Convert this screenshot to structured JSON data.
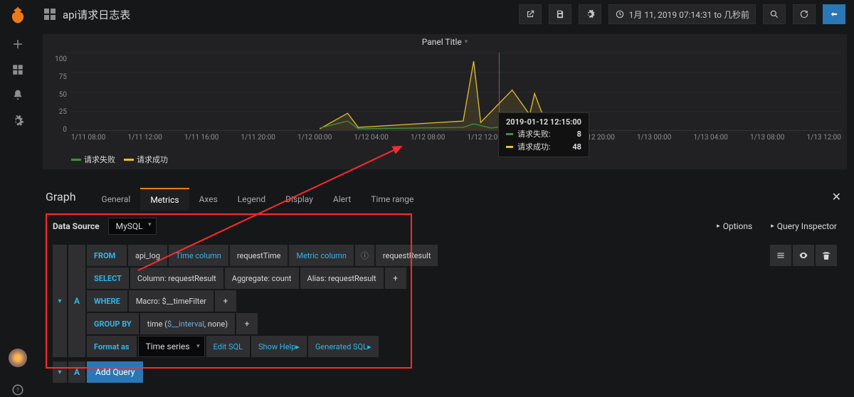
{
  "header": {
    "dashboard_title": "api请求日志表",
    "time_range": "1月 11, 2019 07:14:31 to 几秒前"
  },
  "sidebar": {
    "icons": [
      "plus-icon",
      "apps-icon",
      "bell-icon",
      "gear-icon",
      "help-icon"
    ]
  },
  "panel": {
    "title": "Panel Title",
    "tooltip": {
      "time": "2019-01-12 12:15:00",
      "rows": [
        {
          "label": "请求失败:",
          "value": "8",
          "color": "#3f8f3f"
        },
        {
          "label": "请求成功:",
          "value": "48",
          "color": "#e5c02e"
        }
      ]
    },
    "legend": [
      {
        "label": "请求失败",
        "color": "#3f8f3f"
      },
      {
        "label": "请求成功",
        "color": "#e5c02e"
      }
    ]
  },
  "chart_data": {
    "type": "line",
    "title": "Panel Title",
    "xlabel": "",
    "ylabel": "",
    "ylim": [
      0,
      100
    ],
    "y_ticks": [
      0,
      25,
      50,
      75,
      100
    ],
    "x_ticks": [
      "1/11 08:00",
      "1/11 12:00",
      "1/11 16:00",
      "1/11 20:00",
      "1/12 00:00",
      "1/12 04:00",
      "1/12 08:00",
      "1/12 12:00",
      "1/12 16:00",
      "1/12 20:00",
      "1/13 00:00",
      "1/13 04:00",
      "1/13 08:00",
      "1/13 12:00"
    ],
    "series": [
      {
        "name": "请求失败",
        "color": "#3f8f3f",
        "points": [
          {
            "x": "1/12 01:00",
            "y": 3
          },
          {
            "x": "1/12 02:30",
            "y": 12
          },
          {
            "x": "1/12 03:00",
            "y": 2
          },
          {
            "x": "1/12 08:10",
            "y": 4
          },
          {
            "x": "1/12 09:00",
            "y": 8
          },
          {
            "x": "1/12 10:00",
            "y": 3
          },
          {
            "x": "1/12 11:30",
            "y": 6
          },
          {
            "x": "1/12 12:15",
            "y": 8
          },
          {
            "x": "1/12 12:40",
            "y": 2
          }
        ]
      },
      {
        "name": "请求成功",
        "color": "#e5c02e",
        "points": [
          {
            "x": "1/12 01:00",
            "y": 2
          },
          {
            "x": "1/12 02:30",
            "y": 22
          },
          {
            "x": "1/12 03:00",
            "y": 4
          },
          {
            "x": "1/12 08:10",
            "y": 12
          },
          {
            "x": "1/12 09:00",
            "y": 90
          },
          {
            "x": "1/12 09:30",
            "y": 10
          },
          {
            "x": "1/12 11:00",
            "y": 52
          },
          {
            "x": "1/12 12:00",
            "y": 20
          },
          {
            "x": "1/12 12:15",
            "y": 48
          },
          {
            "x": "1/12 12:40",
            "y": 5
          }
        ]
      }
    ]
  },
  "editor": {
    "section_title": "Graph",
    "tabs": [
      "General",
      "Metrics",
      "Axes",
      "Legend",
      "Display",
      "Alert",
      "Time range"
    ],
    "active_tab": "Metrics",
    "datasource_label": "Data Source",
    "datasource": "MySQL",
    "options_label": "Options",
    "inspector_label": "Query Inspector",
    "query": {
      "letter": "A",
      "from": {
        "kw": "FROM",
        "table": "api_log",
        "time_col_label": "Time column",
        "time_col": "requestTime",
        "metric_col_label": "Metric column",
        "metric_col": "requestResult"
      },
      "select": {
        "kw": "SELECT",
        "column": "Column: requestResult",
        "aggregate": "Aggregate: count",
        "alias": "Alias: requestResult"
      },
      "where": {
        "kw": "WHERE",
        "macro": "Macro: $__timeFilter"
      },
      "groupby": {
        "kw": "GROUP BY",
        "expr_prefix": "time (",
        "interval": "$__interval",
        "rest": ", none",
        ")": ")"
      },
      "format": {
        "kw": "Format as",
        "value": "Time series",
        "edit_sql": "Edit SQL",
        "show_help": "Show Help",
        "gen_sql": "Generated SQL"
      }
    },
    "add_query_label": "Add Query",
    "add_letter": "A"
  }
}
